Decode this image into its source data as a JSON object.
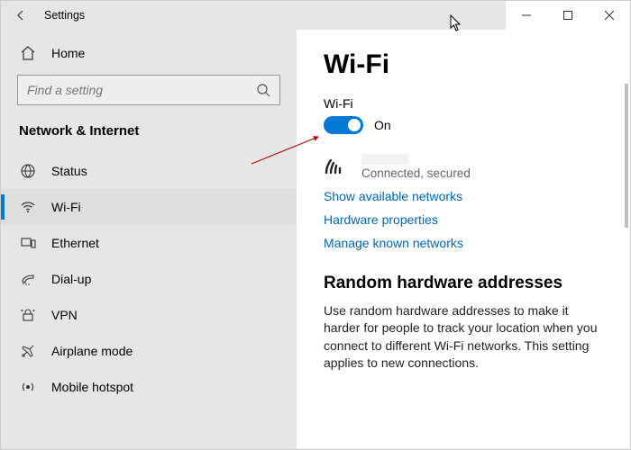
{
  "window": {
    "title": "Settings"
  },
  "sidebar": {
    "home": "Home",
    "search_placeholder": "Find a setting",
    "category": "Network & Internet",
    "items": [
      {
        "label": "Status"
      },
      {
        "label": "Wi-Fi"
      },
      {
        "label": "Ethernet"
      },
      {
        "label": "Dial-up"
      },
      {
        "label": "VPN"
      },
      {
        "label": "Airplane mode"
      },
      {
        "label": "Mobile hotspot"
      }
    ]
  },
  "main": {
    "title": "Wi-Fi",
    "wifi_label": "Wi-Fi",
    "toggle_state": "On",
    "connection_status": "Connected, secured",
    "links": {
      "available": "Show available networks",
      "hardware": "Hardware properties",
      "known": "Manage known networks"
    },
    "random_heading": "Random hardware addresses",
    "random_desc": "Use random hardware addresses to make it harder for people to track your location when you connect to different Wi-Fi networks. This setting applies to new connections."
  }
}
